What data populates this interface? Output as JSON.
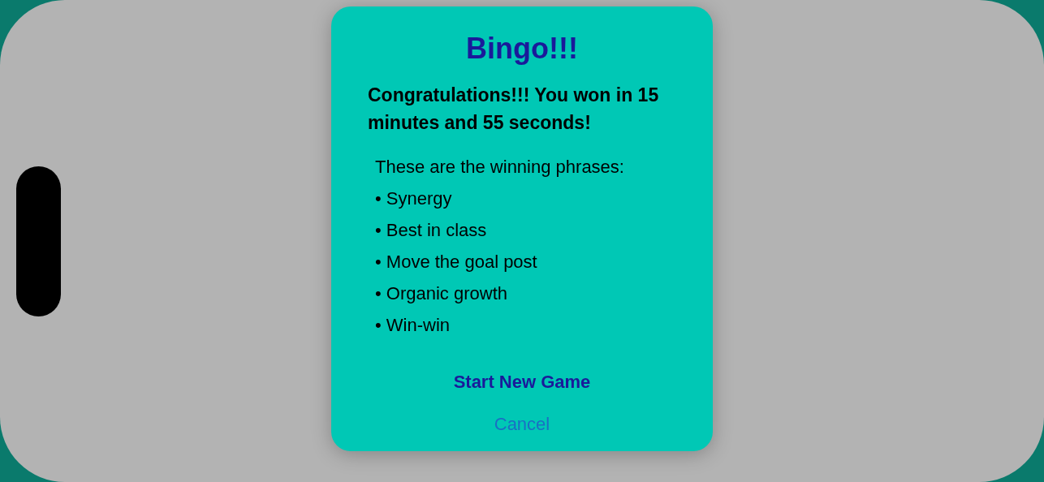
{
  "alert": {
    "title": "Bingo!!!",
    "message": "Congratulations!!! You won in 15 minutes and 55 seconds!",
    "phrases_heading": "These are the winning phrases:",
    "phrases": [
      {
        "text": "• Synergy"
      },
      {
        "text": "• Best in class"
      },
      {
        "text": "• Move the goal post"
      },
      {
        "text": "• Organic growth"
      },
      {
        "text": "• Win-win"
      }
    ],
    "buttons": [
      {
        "label": "Start New Game",
        "kind": "primary"
      },
      {
        "label": "Cancel",
        "kind": "cancel"
      }
    ]
  }
}
